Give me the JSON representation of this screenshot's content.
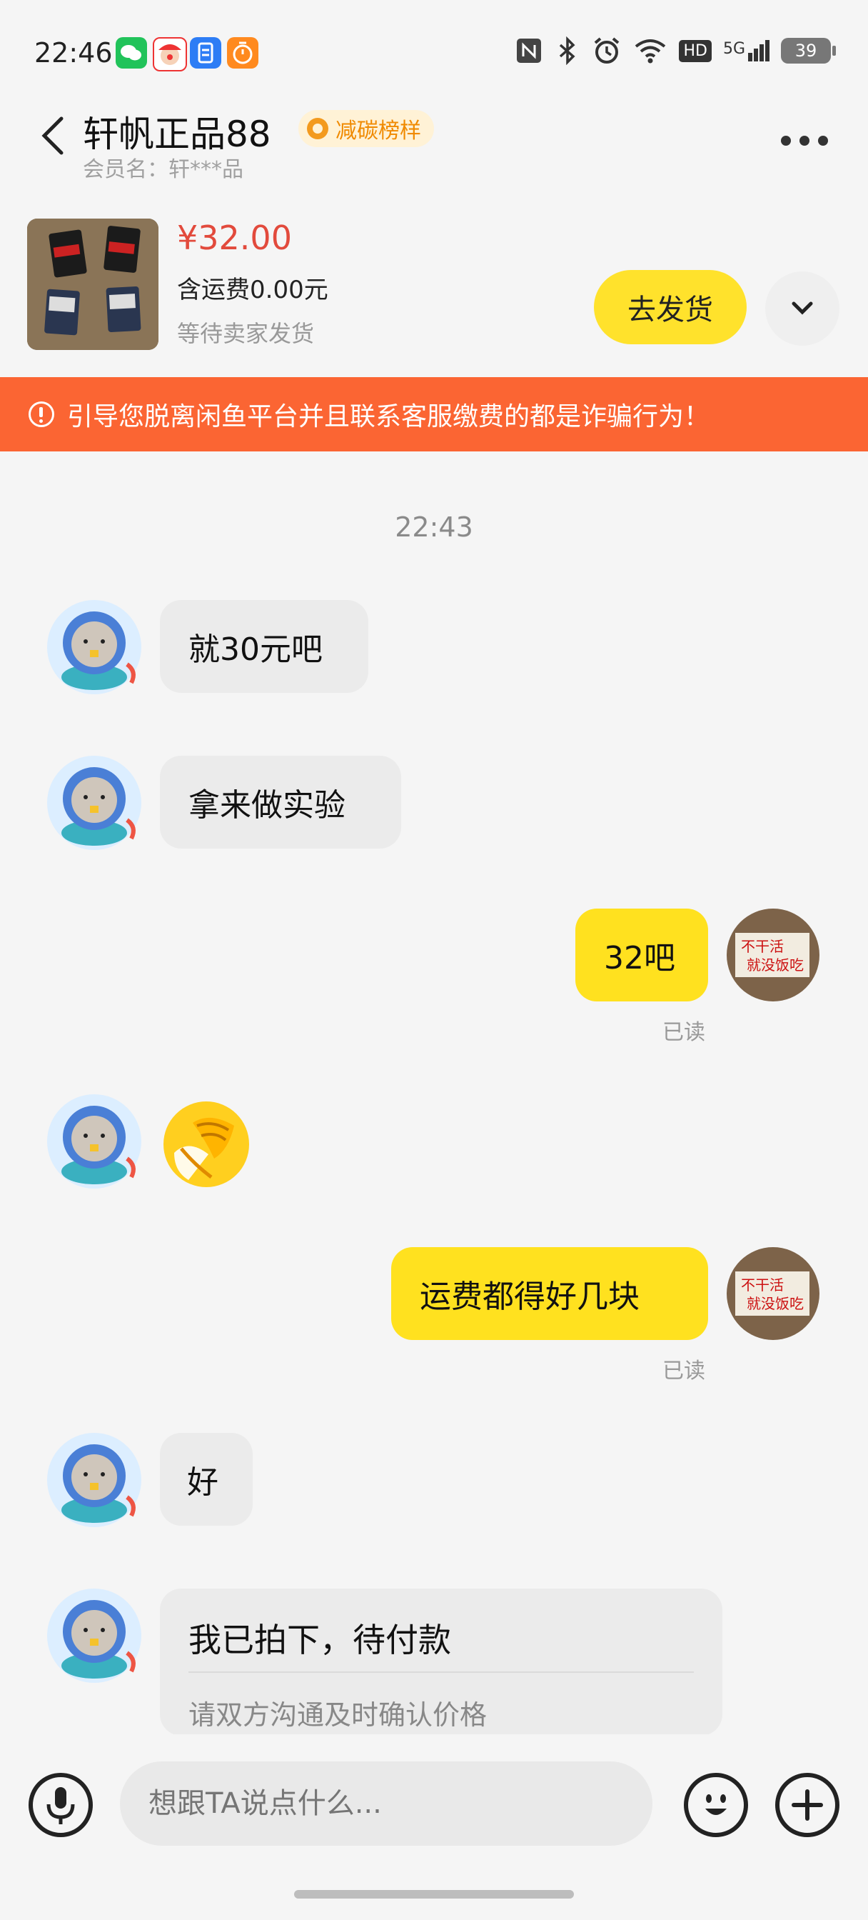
{
  "status_bar": {
    "time": "22:46",
    "network": "5G",
    "hd": "HD",
    "battery": "39"
  },
  "header": {
    "shop_name": "轩帆正品88",
    "badge": "减碳榜样",
    "member_label": "会员名：轩***品"
  },
  "product": {
    "price": "¥32.00",
    "shipping_note": "含运费0.00元",
    "status": "等待卖家发货",
    "ship_button": "去发货"
  },
  "warning": "引导您脱离闲鱼平台并且联系客服缴费的都是诈骗行为！",
  "timestamp": "22:43",
  "messages": [
    {
      "side": "left",
      "text": "就30元吧"
    },
    {
      "side": "left",
      "text": "拿来做实验"
    },
    {
      "side": "right",
      "text": "32吧",
      "status": "已读"
    },
    {
      "side": "left",
      "emoji": "face-palm-laughing"
    },
    {
      "side": "right",
      "text": "运费都得好几块",
      "status": "已读"
    },
    {
      "side": "left",
      "text": "好"
    }
  ],
  "order_card": {
    "title": "我已拍下，待付款",
    "subtitle": "请双方沟通及时确认价格"
  },
  "self_avatar_sign": "不干活 就没饭吃",
  "input": {
    "placeholder": "想跟TA说点什么..."
  },
  "colors": {
    "accent_yellow": "#ffe11f",
    "warning_orange": "#fb6533",
    "price_red": "#e24a3c",
    "badge_orange": "#f08a00"
  }
}
